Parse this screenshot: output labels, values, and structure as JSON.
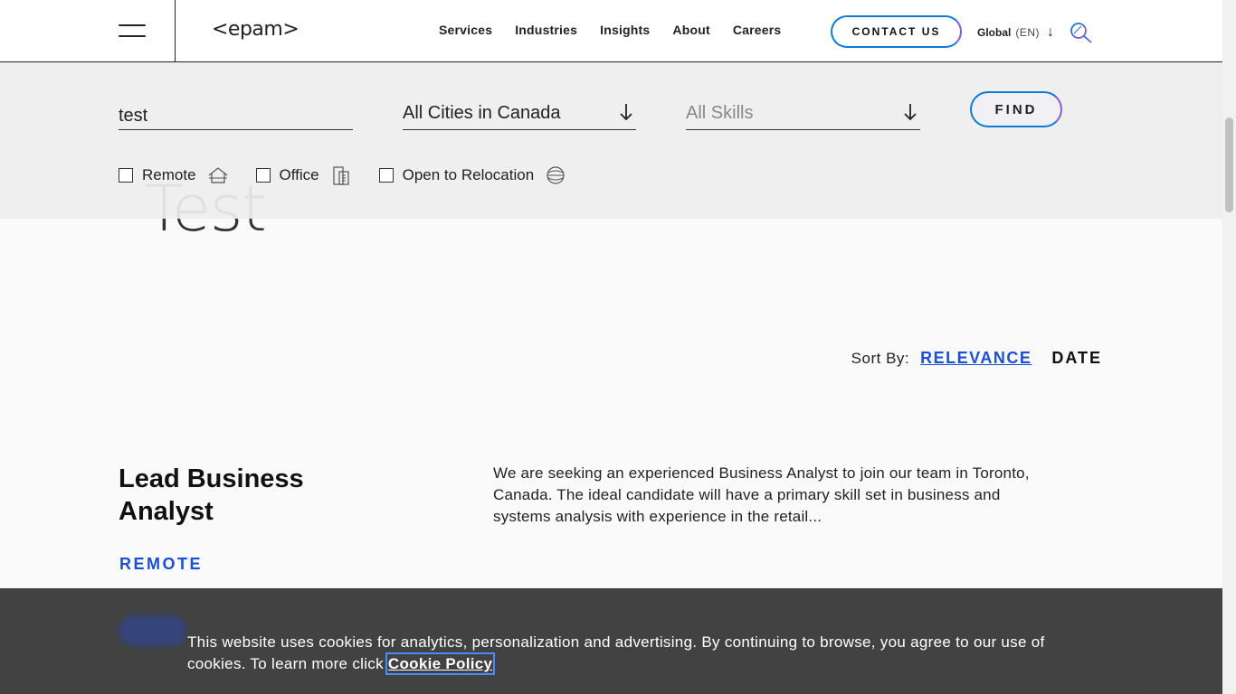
{
  "header": {
    "logo_text": "<epam>",
    "nav": [
      "Services",
      "Industries",
      "Insights",
      "About",
      "Careers"
    ],
    "contact_label": "CONTACT US",
    "global_label": "Global",
    "global_lang": "(EN)"
  },
  "search": {
    "keyword_value": "test",
    "city_value": "All Cities in Canada",
    "skills_placeholder": "All Skills",
    "find_label": "FIND",
    "filters": [
      {
        "label": "Remote",
        "checked": false,
        "icon": "remote-house-icon"
      },
      {
        "label": "Office",
        "checked": false,
        "icon": "office-building-icon"
      },
      {
        "label": "Open to Relocation",
        "checked": false,
        "icon": "relocation-globe-icon"
      }
    ]
  },
  "page": {
    "big_title": "Test"
  },
  "sort": {
    "label": "Sort By:",
    "relevance": "RELEVANCE",
    "date": "DATE"
  },
  "job": {
    "title": "Lead Business Analyst",
    "location_type": "REMOTE",
    "description": "We are seeking an experienced Business Analyst to join our team in Toronto, Canada. The ideal candidate will have a primary skill set in business and systems analysis with experience in the retail..."
  },
  "cookie": {
    "text": "This website uses cookies for analytics, personalization and advertising. By continuing to browse, you agree to our use of cookies. To learn more click ",
    "link": "Cookie Policy"
  },
  "colors": {
    "accent_blue": "#1a4fd6",
    "gradient_start": "#0a7bd8",
    "gradient_end": "#8a5bd6"
  }
}
